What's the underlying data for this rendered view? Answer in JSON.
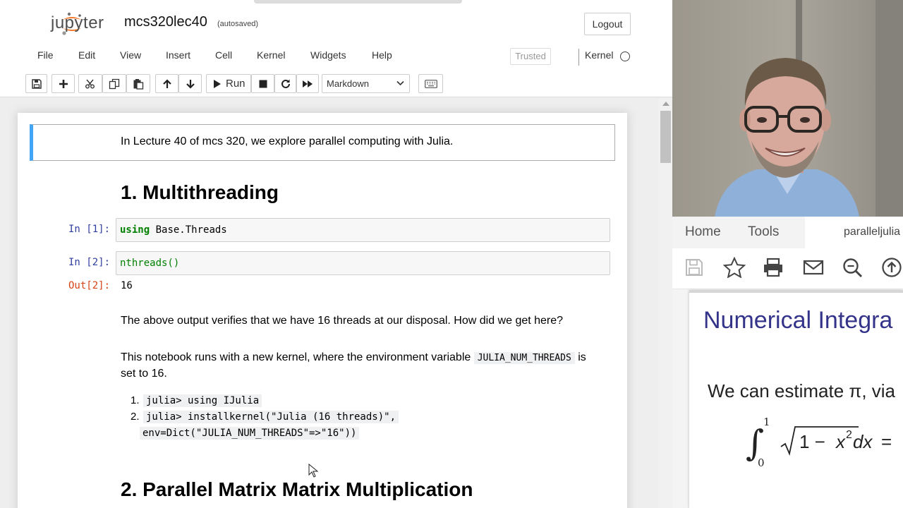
{
  "jupyter": {
    "logo_text": "jupyter",
    "notebook_name": "mcs320lec40",
    "autosaved": "(autosaved)",
    "logout": "Logout",
    "menu": [
      "File",
      "Edit",
      "View",
      "Insert",
      "Cell",
      "Kernel",
      "Widgets",
      "Help"
    ],
    "trusted": "Trusted",
    "kernel_label": "Kernel",
    "toolbar": {
      "run_label": "Run",
      "cell_type": "Markdown",
      "icons": [
        "save-icon",
        "plus-icon",
        "cut-icon",
        "copy-icon",
        "paste-icon",
        "arrow-up-icon",
        "arrow-down-icon",
        "run-icon",
        "stop-icon",
        "restart-icon",
        "fast-forward-icon",
        "keyboard-icon"
      ]
    }
  },
  "notebook": {
    "intro": "In Lecture 40 of mcs 320, we explore parallel computing with Julia.",
    "heading1": "1. Multithreading",
    "cell1": {
      "prompt": "In [1]:",
      "keyword": "using",
      "code_rest": " Base.Threads"
    },
    "cell2": {
      "prompt": "In [2]:",
      "code": "nthreads()"
    },
    "out2": {
      "prompt": "Out[2]:",
      "value": "16"
    },
    "para1": "The above output verifies that we have 16 threads at our disposal. How did we get here?",
    "para2_a": "This notebook runs with a new kernel, where the environment variable",
    "para2_code": "JULIA_NUM_THREADS",
    "para2_b": "is",
    "para2_c": "set to 16.",
    "list": {
      "n1": "1.",
      "item1": "julia> using IJulia",
      "n2": "2.",
      "item2a": "julia> installkernel(\"Julia (16 threads)\",",
      "item2b": "env=Dict(\"JULIA_NUM_THREADS\"=>\"16\"))"
    },
    "heading2": "2. Parallel Matrix Matrix Multiplication"
  },
  "pdf_viewer": {
    "tab_home": "Home",
    "tab_tools": "Tools",
    "file_tab": "paralleljulia",
    "icons": [
      "save-icon",
      "star-icon",
      "print-icon",
      "mail-icon",
      "zoom-icon",
      "upload-icon"
    ],
    "page_title": "Numerical Integra",
    "page_text": "We can estimate π, via",
    "formula": "∫₀¹ √(1 − x²) dx ="
  },
  "colors": {
    "jupyter_orange": "#f37726",
    "selected_cell_bar": "#42a5f5",
    "in_prompt": "#303f9f",
    "out_prompt": "#d84315",
    "keyword_green": "#008000",
    "pdf_title_blue": "#33338a"
  }
}
